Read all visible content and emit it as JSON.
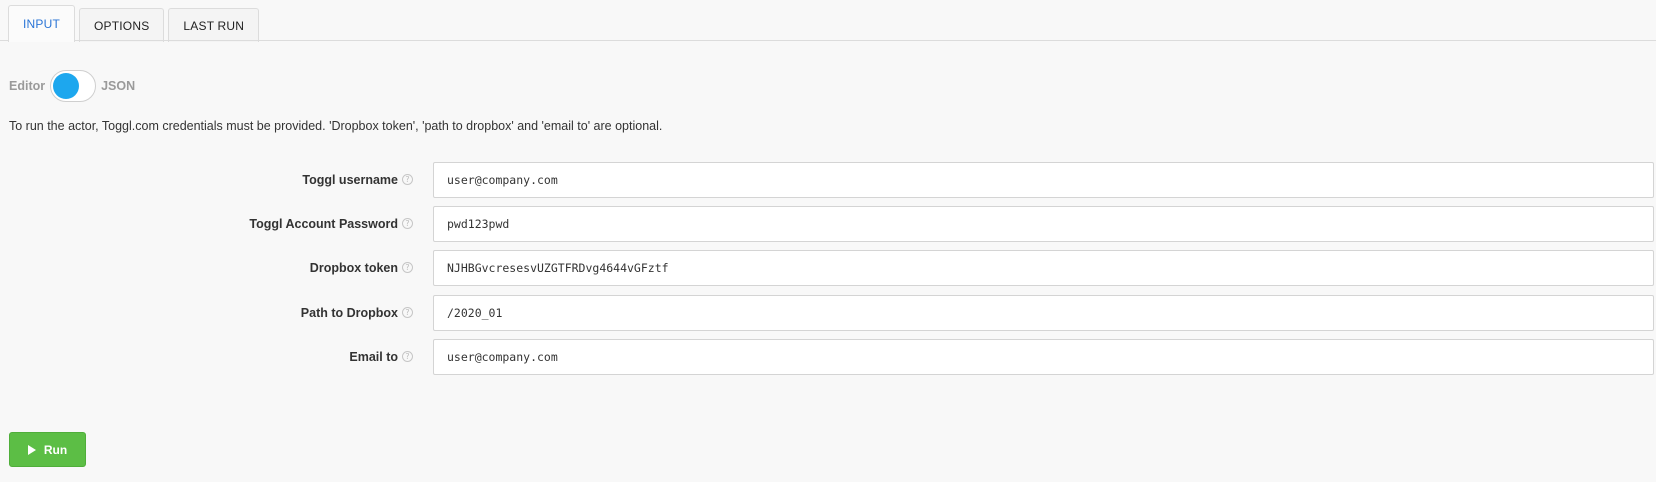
{
  "tabs": [
    {
      "label": "INPUT",
      "active": true
    },
    {
      "label": "OPTIONS",
      "active": false
    },
    {
      "label": "LAST RUN",
      "active": false
    }
  ],
  "mode_toggle": {
    "left_label": "Editor",
    "right_label": "JSON",
    "selected": "Editor",
    "accent": "#1da7ee"
  },
  "description": "To run the actor, Toggl.com credentials must be provided. 'Dropbox token', 'path to dropbox' and 'email to' are optional.",
  "form": {
    "fields": [
      {
        "label": "Toggl username",
        "value": "user@company.com",
        "icon": "question-circle-icon"
      },
      {
        "label": "Toggl Account Password",
        "value": "pwd123pwd",
        "icon": "question-circle-icon"
      },
      {
        "label": "Dropbox token",
        "value": "NJHBGvcresesvUZGTFRDvg4644vGFztf",
        "icon": "question-circle-icon"
      },
      {
        "label": "Path to Dropbox",
        "value": "/2020_01",
        "icon": "question-circle-icon"
      },
      {
        "label": "Email to",
        "value": "user@company.com",
        "icon": "question-circle-icon"
      }
    ]
  },
  "run_button": {
    "label": "Run",
    "icon": "play-icon",
    "color": "#5cbe45"
  },
  "colors": {
    "tab_active": "#2b75d6",
    "background": "#f8f8f8"
  }
}
